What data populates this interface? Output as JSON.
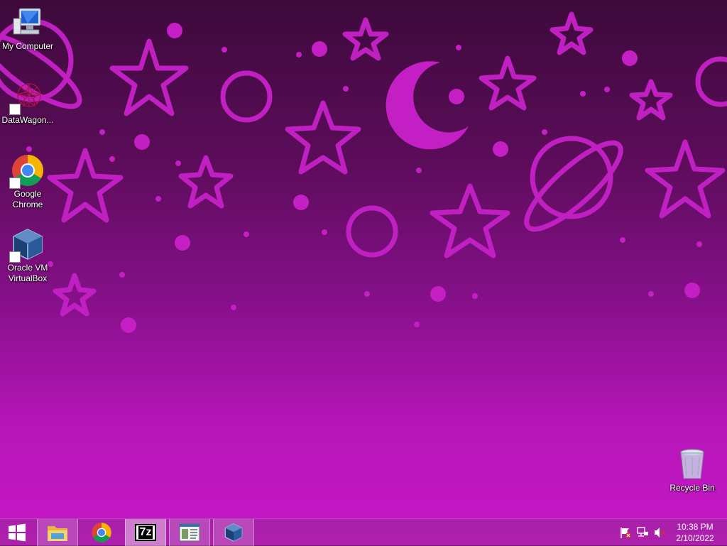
{
  "desktop": {
    "icons": [
      {
        "label": "My Computer",
        "name": "my-computer-icon"
      },
      {
        "label": "DataWagon...",
        "name": "datawagon-icon"
      },
      {
        "label": "Google\nChrome",
        "name": "google-chrome-icon"
      },
      {
        "label": "Oracle VM\nVirtualBox",
        "name": "virtualbox-icon"
      },
      {
        "label": "Recycle Bin",
        "name": "recycle-bin-icon"
      }
    ]
  },
  "taskbar": {
    "start_icon": "windows-logo-icon",
    "pinned": [
      {
        "name": "file-explorer-icon"
      },
      {
        "name": "chrome-icon"
      },
      {
        "name": "7zip-icon",
        "text": "7z"
      },
      {
        "name": "document-window-icon"
      },
      {
        "name": "virtualbox-icon"
      }
    ],
    "tray": {
      "icons": [
        "action-center-flag-icon",
        "network-icon",
        "volume-muted-icon"
      ],
      "time": "10:38 PM",
      "date": "2/10/2022"
    }
  },
  "colors": {
    "wallpaper_top": "#3d0a3b",
    "wallpaper_bottom": "#c818c8",
    "motif": "#c41fc4"
  }
}
